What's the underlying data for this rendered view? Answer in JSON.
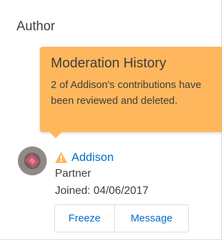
{
  "card": {
    "title": "Author"
  },
  "popover": {
    "heading": "Moderation History",
    "body": "2 of Addison's contributions have been reviewed and deleted.",
    "color": "#ffb75d"
  },
  "author": {
    "name": "Addison",
    "role": "Partner",
    "joined": "Joined: 04/06/2017",
    "warning_icon": "warning-icon",
    "warning_color": "#ffb75d",
    "link_color": "#006dcc"
  },
  "actions": {
    "freeze_label": "Freeze",
    "message_label": "Message"
  }
}
